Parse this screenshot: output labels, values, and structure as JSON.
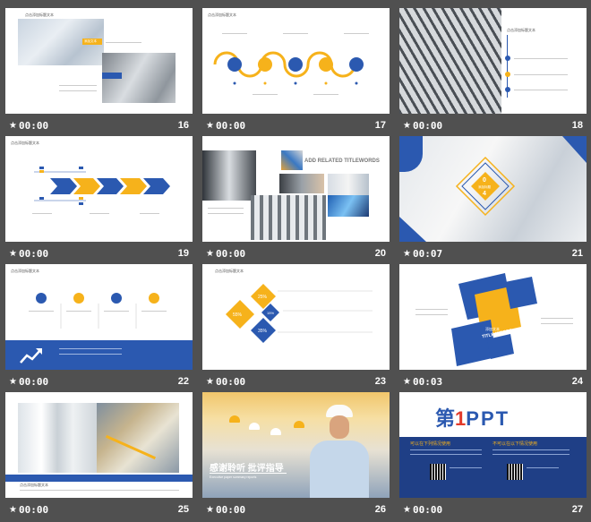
{
  "slides": [
    {
      "time": "00:00",
      "num": "16"
    },
    {
      "time": "00:00",
      "num": "17"
    },
    {
      "time": "00:00",
      "num": "18"
    },
    {
      "time": "00:00",
      "num": "19"
    },
    {
      "time": "00:00",
      "num": "20"
    },
    {
      "time": "00:07",
      "num": "21"
    },
    {
      "time": "00:00",
      "num": "22"
    },
    {
      "time": "00:00",
      "num": "23"
    },
    {
      "time": "00:03",
      "num": "24"
    },
    {
      "time": "00:00",
      "num": "25"
    },
    {
      "time": "00:00",
      "num": "26"
    },
    {
      "time": "00:00",
      "num": "27"
    }
  ],
  "s16": {
    "title": "点击添加标题文本",
    "label": "添加文本"
  },
  "s17": {
    "title": "点击添加标题文本"
  },
  "s18": {
    "title": "点击添加标题文本"
  },
  "s19": {
    "title": "点击添加标题文本"
  },
  "s20": {
    "heading": "ADD RELATED TITLEWORDS"
  },
  "s21": {
    "num": "0",
    "num2": "4",
    "label": "添加标题"
  },
  "s22": {
    "title": "点击添加标题文本"
  },
  "s23": {
    "title": "点击添加标题文本",
    "pct1": "55%",
    "pct2": "25%",
    "pct3": "15%",
    "pct4": "35%"
  },
  "s24": {
    "title": "添加文本",
    "subtitle": "TITLE WORDS"
  },
  "s25": {
    "title": "点击添加标题文本"
  },
  "s26": {
    "text": "感谢聆听  批评指导",
    "sub": "Executive  paper  summary  reports"
  },
  "s27": {
    "logo_prefix": "第",
    "logo_num": "1",
    "logo_suffix": "PPT",
    "left_head": "可以在下列情况使用",
    "right_head": "不可以在以下情况使用"
  },
  "colors": {
    "blue": "#2b59b0",
    "yellow": "#f6b21b",
    "bg": "#505050"
  }
}
